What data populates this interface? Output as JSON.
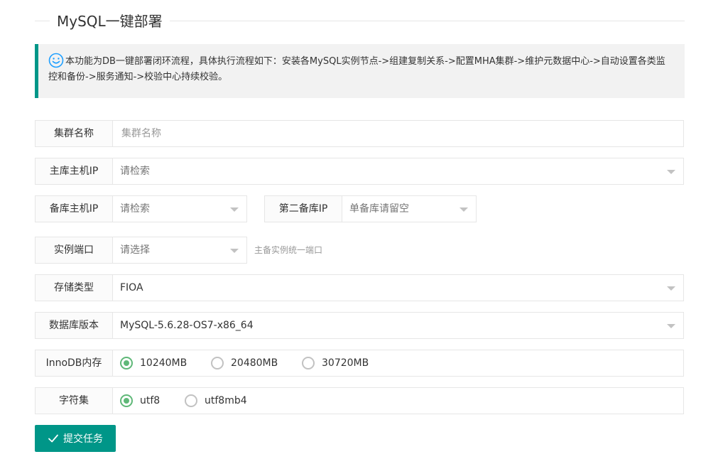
{
  "header": {
    "title": "MySQL一键部署"
  },
  "notice": {
    "icon": "smile-icon",
    "accent_color": "#009688",
    "text": "本功能为DB一键部署闭环流程，具体执行流程如下：安装各MySQL实例节点->组建复制关系->配置MHA集群->维护元数据中心->自动设置各类监控和备份->服务通知->校验中心持续校验。"
  },
  "form": {
    "cluster_name": {
      "label": "集群名称",
      "placeholder": "集群名称"
    },
    "master_ip": {
      "label": "主库主机IP",
      "placeholder": "请检索"
    },
    "slave_ip": {
      "label": "备库主机IP",
      "placeholder": "请检索"
    },
    "second_slave_ip": {
      "label": "第二备库IP",
      "placeholder": "单备库请留空"
    },
    "port": {
      "label": "实例端口",
      "placeholder": "请选择",
      "hint": "主备实例统一端口"
    },
    "storage_type": {
      "label": "存储类型",
      "value": "FIOA"
    },
    "db_version": {
      "label": "数据库版本",
      "value": "MySQL-5.6.28-OS7-x86_64"
    },
    "innodb_memory": {
      "label": "InnoDB内存",
      "options": [
        "10240MB",
        "20480MB",
        "30720MB"
      ],
      "selected": "10240MB"
    },
    "charset": {
      "label": "字符集",
      "options": [
        "utf8",
        "utf8mb4"
      ],
      "selected": "utf8"
    }
  },
  "submit": {
    "label": "提交任务",
    "icon": "check-icon",
    "color": "#009688"
  }
}
